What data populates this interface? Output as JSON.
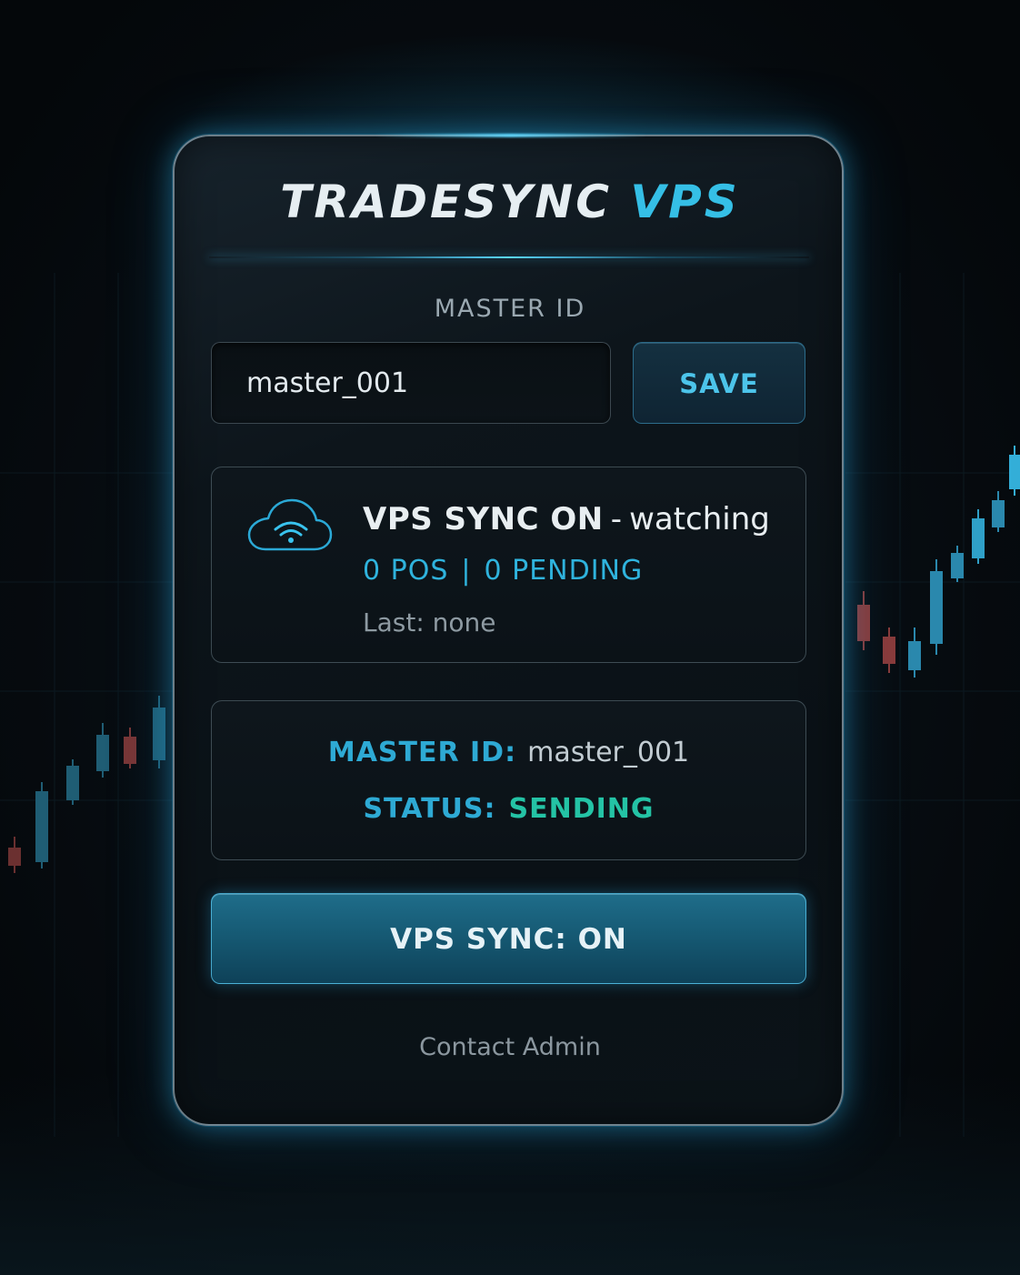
{
  "app": {
    "title_part1": "TRADESYNC",
    "title_part2": "VPS"
  },
  "master_field": {
    "label": "MASTER ID",
    "value": "master_001",
    "save_label": "SAVE"
  },
  "sync_card": {
    "icon": "cloud-wifi-icon",
    "title_state": "VPS SYNC ON",
    "title_separator": "-",
    "title_mode": "watching",
    "positions": "0 POS",
    "counts_separator": "|",
    "pending": "0 PENDING",
    "last_label": "Last:",
    "last_value": "none"
  },
  "info_card": {
    "master_key": "MASTER ID:",
    "master_value": "master_001",
    "status_key": "STATUS:",
    "status_value": "SENDING"
  },
  "toggle": {
    "label": "VPS SYNC: ON"
  },
  "footer": {
    "contact_label": "Contact Admin"
  },
  "colors": {
    "accent": "#35bfe6",
    "status_ok": "#24c3a5",
    "background": "#05090d",
    "button_fill": "#1a6380"
  }
}
